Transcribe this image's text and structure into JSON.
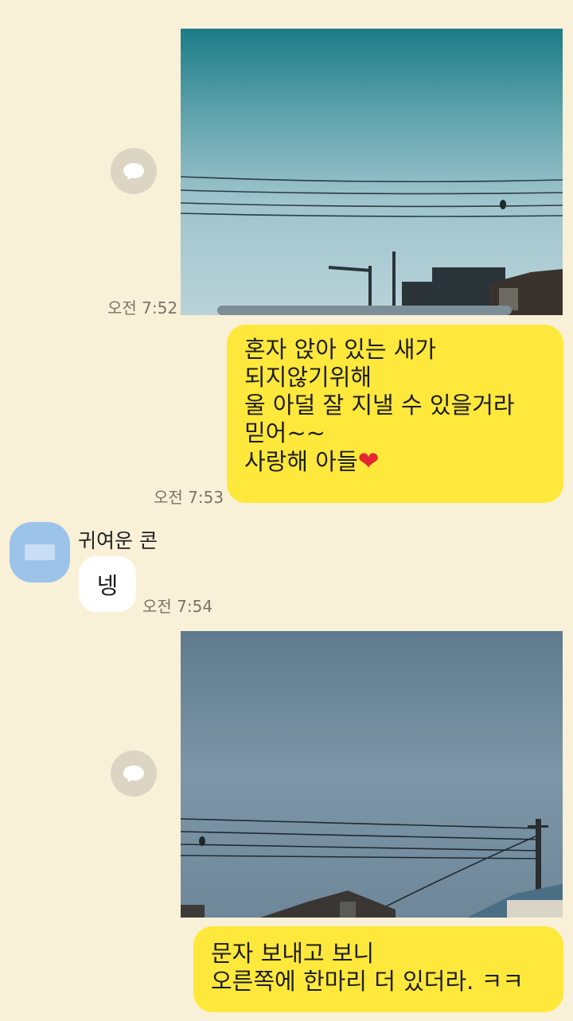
{
  "messages": [
    {
      "time": "오전 7:52"
    },
    {
      "lines": [
        "혼자 앉아 있는 새가",
        "되지않기위해",
        "울 아덜 잘 지낼 수 있을거라",
        "믿어~~",
        "사랑해 아들"
      ],
      "emoji": "❤",
      "time": "오전 7:53"
    },
    {
      "sender": "귀여운 콘",
      "text": "넹",
      "time": "오전 7:54"
    },
    {
      "lines": [
        "문자 보내고 보니",
        "오른쪽에 한마리 더 있더라. ㅋㅋ"
      ]
    }
  ],
  "colors": {
    "background": "#f9f0d8",
    "my_bubble": "#fee83c",
    "their_bubble": "#ffffff",
    "avatar": "#9cc3ea",
    "heart": "#e3262f"
  },
  "icons": {
    "share": "share-icon"
  }
}
